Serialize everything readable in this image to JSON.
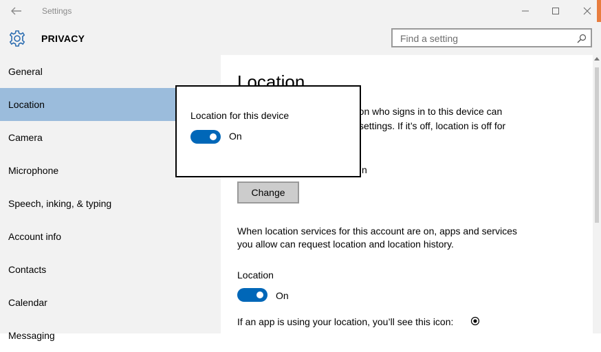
{
  "window": {
    "title": "Settings",
    "back_icon": "back-arrow-icon",
    "controls": [
      "minimize-icon",
      "maximize-icon",
      "close-icon"
    ]
  },
  "header": {
    "section": "PRIVACY",
    "icon": "gear-icon",
    "search_placeholder": "Find a setting"
  },
  "sidebar": {
    "items": [
      {
        "label": "General"
      },
      {
        "label": "Location",
        "selected": true
      },
      {
        "label": "Camera"
      },
      {
        "label": "Microphone"
      },
      {
        "label": "Speech, inking, & typing"
      },
      {
        "label": "Account info"
      },
      {
        "label": "Contacts"
      },
      {
        "label": "Calendar"
      },
      {
        "label": "Messaging"
      }
    ]
  },
  "main": {
    "heading": "Location",
    "desc_line1": "rson who signs in to this device can",
    "desc_line2": "settings. If it’s off, location is off for",
    "status_fragment": "n",
    "change_label": "Change",
    "account_text_line1": "When location services for this account are on, apps and services",
    "account_text_line2": "you allow can request location and location history.",
    "location_label": "Location",
    "location_state": "On",
    "icon_text": "If an app is using your location, you’ll see this icon:"
  },
  "popup": {
    "title": "Location for this device",
    "state": "On"
  },
  "colors": {
    "accent": "#0067b8",
    "selected_bg": "#9bbcdc",
    "chrome_bg": "#f2f2f2"
  }
}
